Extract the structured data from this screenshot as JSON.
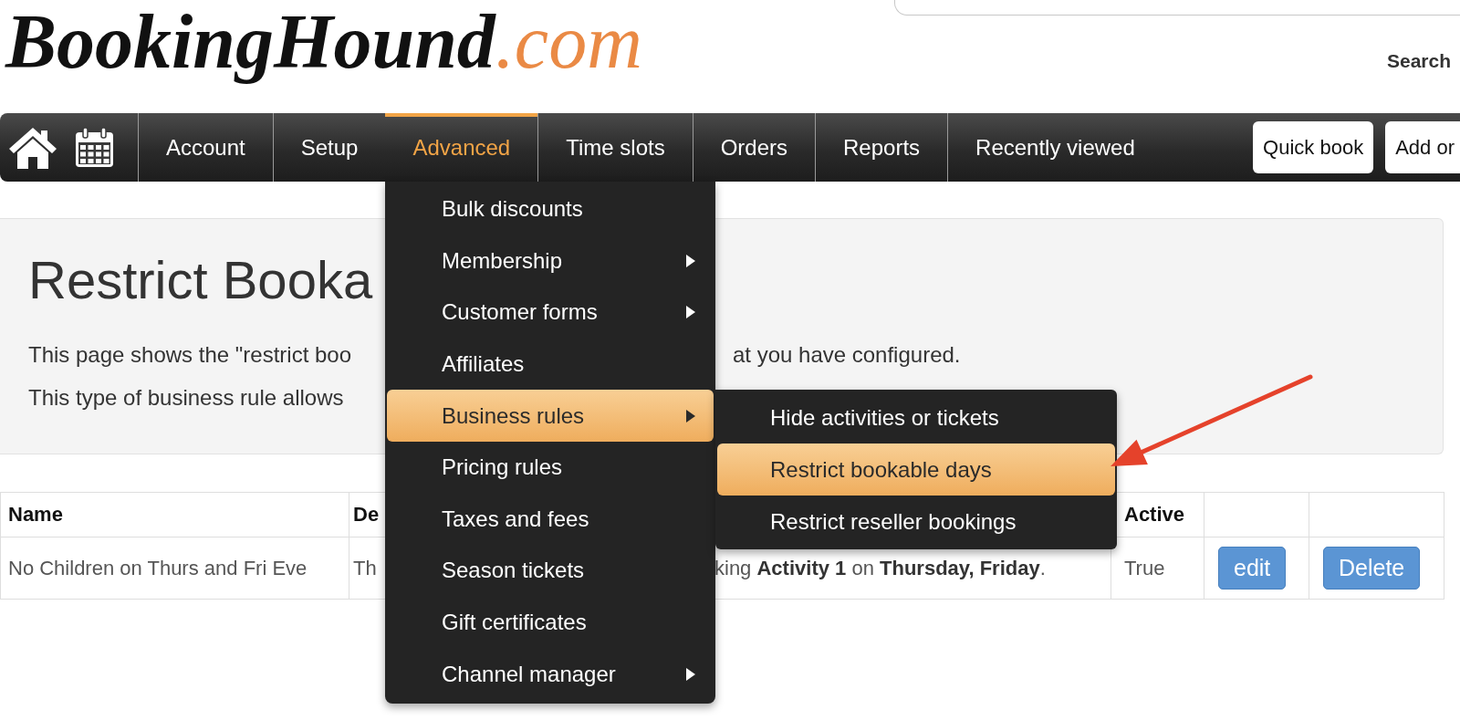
{
  "header": {
    "logo": {
      "name": "BookingHound",
      "suffix": ".com"
    },
    "search": {
      "button": "Search"
    }
  },
  "nav": {
    "items": [
      {
        "label": "Account",
        "selected": false
      },
      {
        "label": "Setup",
        "selected": false
      },
      {
        "label": "Advanced",
        "selected": true
      },
      {
        "label": "Time slots",
        "selected": false
      },
      {
        "label": "Orders",
        "selected": false
      },
      {
        "label": "Reports",
        "selected": false
      },
      {
        "label": "Recently viewed",
        "selected": false
      }
    ],
    "buttons": [
      "Quick book",
      "Add or"
    ]
  },
  "menu": {
    "items": [
      {
        "label": "Bulk discounts",
        "has_submenu": false,
        "selected": false
      },
      {
        "label": "Membership",
        "has_submenu": true,
        "selected": false
      },
      {
        "label": "Customer forms",
        "has_submenu": true,
        "selected": false
      },
      {
        "label": "Affiliates",
        "has_submenu": false,
        "selected": false
      },
      {
        "label": "Business rules",
        "has_submenu": true,
        "selected": true,
        "children": [
          {
            "label": "Hide activities or tickets",
            "selected": false
          },
          {
            "label": "Restrict bookable days",
            "selected": true
          },
          {
            "label": "Restrict reseller bookings",
            "selected": false
          }
        ]
      },
      {
        "label": "Pricing rules",
        "has_submenu": false,
        "selected": false
      },
      {
        "label": "Taxes and fees",
        "has_submenu": false,
        "selected": false
      },
      {
        "label": "Season tickets",
        "has_submenu": false,
        "selected": false
      },
      {
        "label": "Gift certificates",
        "has_submenu": false,
        "selected": false
      },
      {
        "label": "Channel manager",
        "has_submenu": true,
        "selected": false
      }
    ]
  },
  "panel": {
    "title": "Restrict Booka",
    "lines": [
      {
        "before": "This page shows the \"restrict boo",
        "after": "at you have configured."
      },
      {
        "before": "This type of business rule allows"
      }
    ]
  },
  "table": {
    "columns": [
      "Name",
      "De",
      "Active"
    ],
    "rows": [
      {
        "name": "No Children on Thurs and Fri Eve",
        "description": {
          "before": "Th",
          "after": "king **Activity 1** on **Thursday, Friday**."
        },
        "active": "True",
        "actions": [
          "edit",
          "Delete"
        ]
      }
    ]
  }
}
